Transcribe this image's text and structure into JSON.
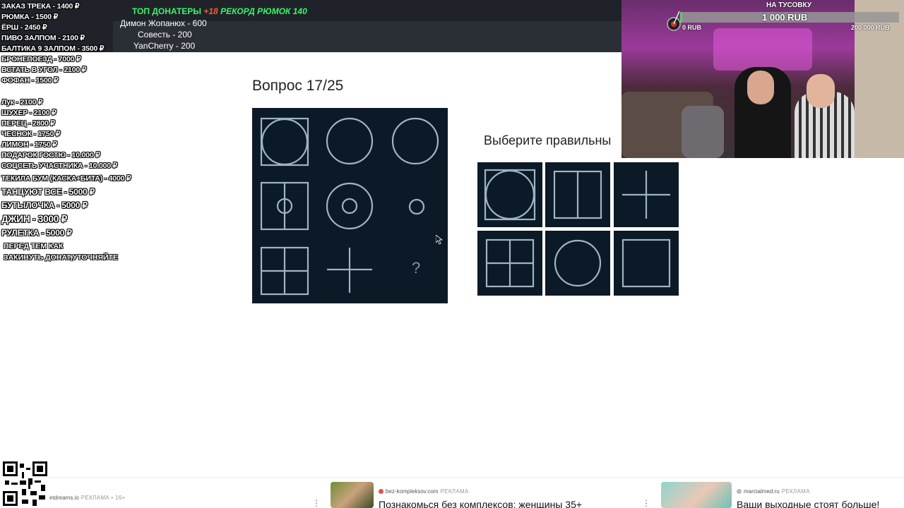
{
  "stream": {
    "top_donors_title": "ТОП ДОНАТЕРЫ",
    "age_badge": "+18",
    "record": "РЕКОРД РЮМОК 140",
    "donors": [
      "Димон Жопанюх - 600",
      "Совесть - 200",
      "YanCherry - 200"
    ],
    "price_list": [
      "ЗАКАЗ ТРЕКА - 1400 ₽",
      "РЮМКА - 1500 ₽",
      "ЁРШ - 2450 ₽",
      "ПИВО ЗАЛПОМ - 2100 ₽",
      "БАЛТИКА 9 ЗАЛПОМ - 3500 ₽",
      "БРОНЕПОЕЗД - 7000 ₽",
      "ВСТАТЬ В УГОЛ - 2100 ₽",
      "ФОФАН - 1500 ₽",
      "Лук - 2100 ₽",
      "ШУХЕР - 2100 ₽",
      "ПЕРЕЦ - 2800 ₽",
      "ЧЕСНОК - 1750 ₽",
      "ЛИМОН - 1750 ₽",
      "ПОДАРОК ГОСТЮ - 10.000 ₽",
      "СОЦСЕТЬ УЧАСТНИКА - 10.000 ₽",
      "ТЕКИЛА БУМ (КАСКА+БИТА) - 4000 ₽",
      "ТАНЦУЮТ ВСЕ - 5000 ₽",
      "БУТЫЛОЧКА - 5000 ₽",
      "ДЖИН - 3000 ₽",
      "РУЛЕТКА - 5000 ₽"
    ],
    "note_line1": "ПЕРЕД ТЕМ КАК",
    "note_line2": "ЗАКИНУТЬ ДОНАТ,УТОЧНЯЙТЕ",
    "goal": {
      "label": "НА ТУСОВКУ",
      "value": "1 000 RUB",
      "min": "0 RUB",
      "max": "200 000 RUB",
      "progress_fraction": 0.005
    }
  },
  "quiz": {
    "question_title": "Вопрос 17/25",
    "prompt": "Выберите правильны",
    "missing_mark": "?"
  },
  "ads": [
    {
      "source": "etdreams.io",
      "tag": "РЕКЛАМА • 16+",
      "title": ""
    },
    {
      "source": "bez-kompleksov.com",
      "tag": "РЕКЛАМА",
      "title": "Познакомься без комплексов: женщины 35+"
    },
    {
      "source": "marcialmed.ru",
      "tag": "РЕКЛАМА",
      "title": "Ваши выходные стоят больше!"
    }
  ],
  "colors": {
    "donors_green": "#3df26a",
    "age_red": "#ff5a2a",
    "matrix_bg": "#0c1a28",
    "figure_stroke": "#9fb4c4",
    "goal_fill": "#5ccf5c"
  }
}
